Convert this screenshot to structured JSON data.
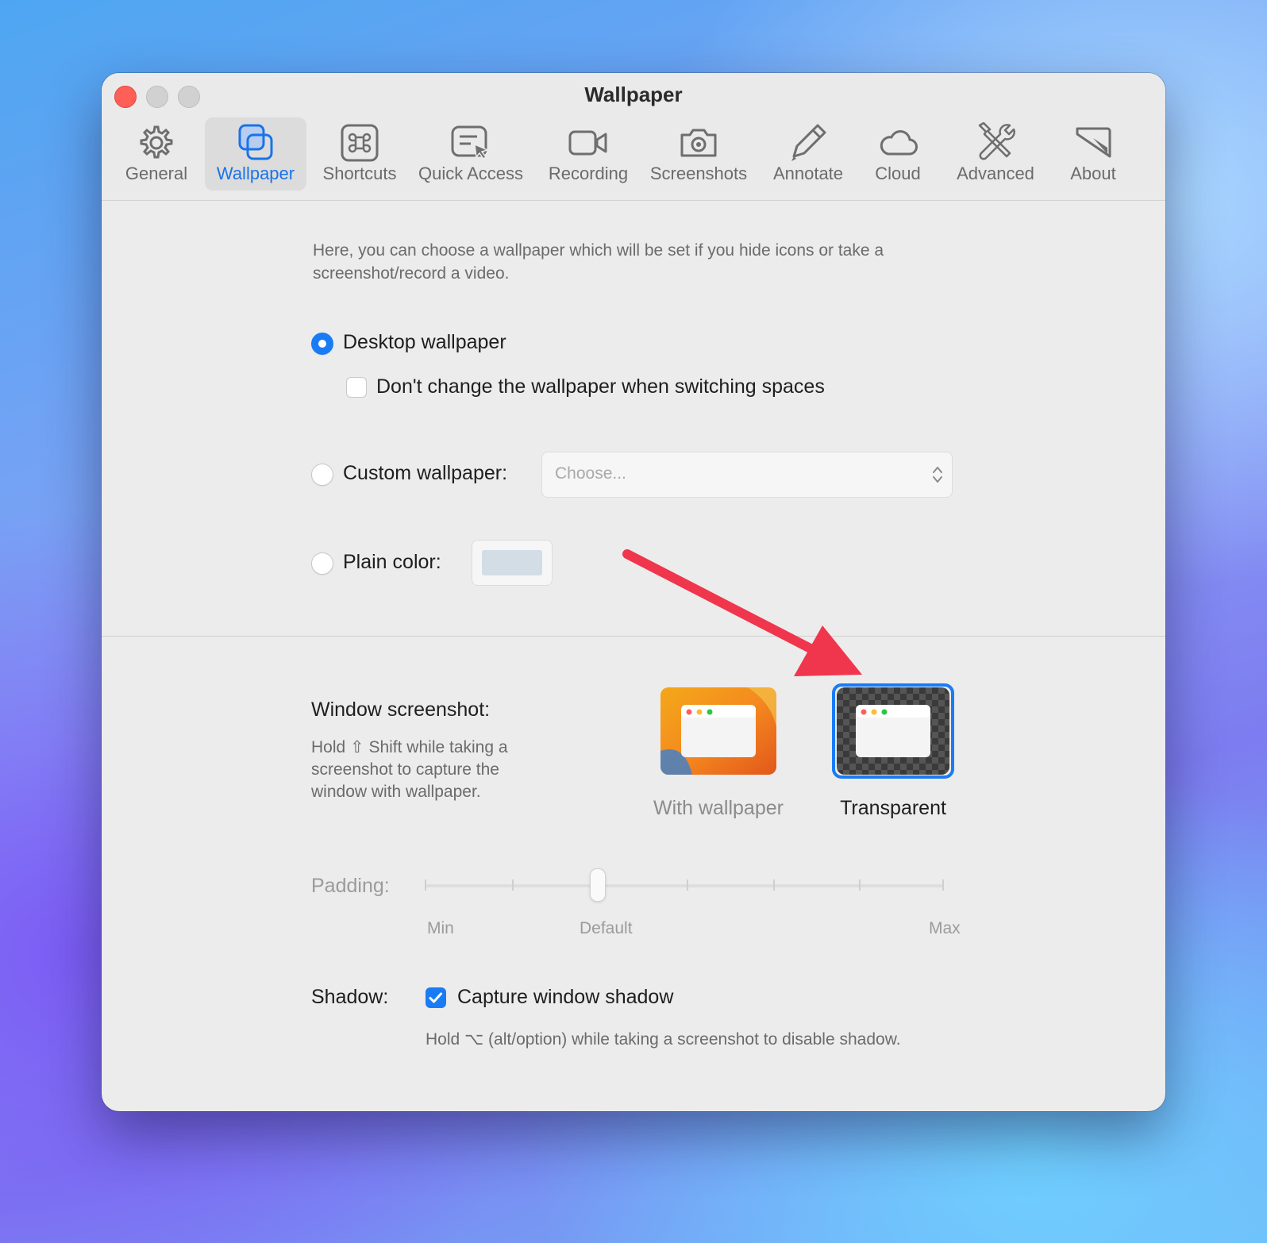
{
  "window": {
    "title": "Wallpaper"
  },
  "tabs": [
    {
      "label": "General",
      "icon": "gear-icon",
      "active": false
    },
    {
      "label": "Wallpaper",
      "icon": "wallpaper-icon",
      "active": true
    },
    {
      "label": "Shortcuts",
      "icon": "command-key-icon",
      "active": false
    },
    {
      "label": "Quick Access",
      "icon": "quick-access-icon",
      "active": false
    },
    {
      "label": "Recording",
      "icon": "video-camera-icon",
      "active": false
    },
    {
      "label": "Screenshots",
      "icon": "camera-icon",
      "active": false
    },
    {
      "label": "Annotate",
      "icon": "pencil-icon",
      "active": false
    },
    {
      "label": "Cloud",
      "icon": "cloud-icon",
      "active": false
    },
    {
      "label": "Advanced",
      "icon": "tools-icon",
      "active": false
    },
    {
      "label": "About",
      "icon": "about-icon",
      "active": false
    }
  ],
  "wallpaper": {
    "intro": "Here, you can choose a wallpaper which will be set if you hide icons or take a screenshot/record a video.",
    "options": {
      "desktop_label": "Desktop wallpaper",
      "desktop_selected": true,
      "dont_change_label": "Don't change the wallpaper when switching spaces",
      "dont_change_checked": false,
      "custom_label": "Custom wallpaper:",
      "custom_selected": false,
      "custom_placeholder": "Choose...",
      "plain_label": "Plain color:",
      "plain_selected": false,
      "plain_color": "#d3dde6"
    }
  },
  "window_screenshot": {
    "title": "Window screenshot:",
    "hint": "Hold ⇧ Shift while taking a screenshot to capture the window with wallpaper.",
    "choices": [
      {
        "label": "With wallpaper",
        "selected": false
      },
      {
        "label": "Transparent",
        "selected": true
      }
    ]
  },
  "padding": {
    "label": "Padding:",
    "min_label": "Min",
    "default_label": "Default",
    "max_label": "Max",
    "value_fraction": 0.34
  },
  "shadow": {
    "label": "Shadow:",
    "checkbox_label": "Capture window shadow",
    "checked": true,
    "hint": "Hold ⌥ (alt/option) while taking a screenshot to disable shadow."
  },
  "colors": {
    "accent": "#1a7cf5",
    "annotation_arrow": "#f0364c"
  }
}
